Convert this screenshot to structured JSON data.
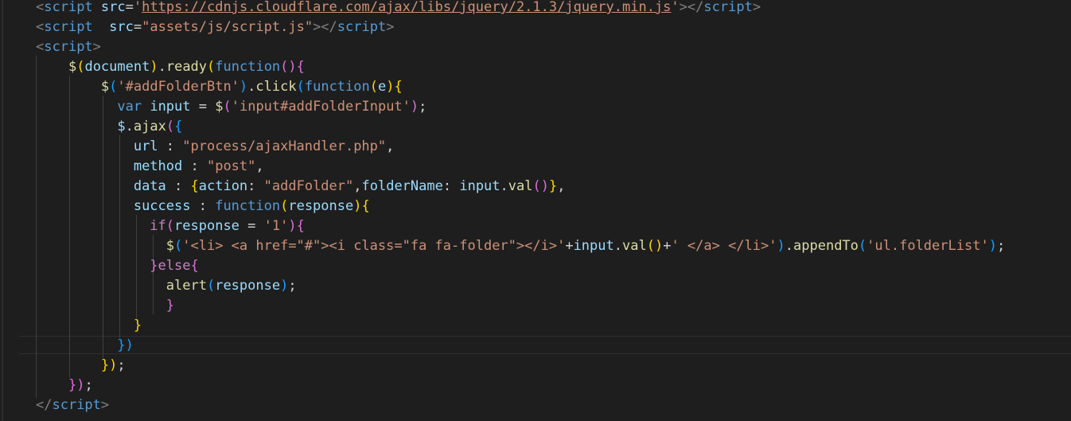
{
  "lines": [
    [
      {
        "t": "<",
        "c": "tok-bracket"
      },
      {
        "t": "script",
        "c": "tok-tag"
      },
      {
        "t": " ",
        "c": "tok-plain"
      },
      {
        "t": "src",
        "c": "tok-attr"
      },
      {
        "t": "=",
        "c": "tok-plain"
      },
      {
        "t": "'",
        "c": "tok-str"
      },
      {
        "t": "https://cdnjs.cloudflare.com/ajax/libs/jquery/2.1.3/jquery.min.js",
        "c": "tok-link"
      },
      {
        "t": "'",
        "c": "tok-str"
      },
      {
        "t": "></",
        "c": "tok-bracket"
      },
      {
        "t": "script",
        "c": "tok-tag"
      },
      {
        "t": ">",
        "c": "tok-bracket"
      }
    ],
    [
      {
        "t": "<",
        "c": "tok-bracket"
      },
      {
        "t": "script",
        "c": "tok-tag"
      },
      {
        "t": "  ",
        "c": "tok-plain"
      },
      {
        "t": "src",
        "c": "tok-attr"
      },
      {
        "t": "=",
        "c": "tok-plain"
      },
      {
        "t": "\"assets/js/script.js\"",
        "c": "tok-str"
      },
      {
        "t": "></",
        "c": "tok-bracket"
      },
      {
        "t": "script",
        "c": "tok-tag"
      },
      {
        "t": ">",
        "c": "tok-bracket"
      }
    ],
    [
      {
        "t": "<",
        "c": "tok-bracket"
      },
      {
        "t": "script",
        "c": "tok-tag"
      },
      {
        "t": ">",
        "c": "tok-bracket"
      }
    ],
    [
      {
        "t": "    ",
        "c": "tok-plain"
      },
      {
        "t": "$",
        "c": "tok-fn"
      },
      {
        "t": "(",
        "c": "b1"
      },
      {
        "t": "document",
        "c": "tok-var"
      },
      {
        "t": ")",
        "c": "b1"
      },
      {
        "t": ".",
        "c": "tok-plain"
      },
      {
        "t": "ready",
        "c": "tok-fn"
      },
      {
        "t": "(",
        "c": "b1"
      },
      {
        "t": "function",
        "c": "tok-kw"
      },
      {
        "t": "()",
        "c": "b2"
      },
      {
        "t": "{",
        "c": "b2"
      }
    ],
    [
      {
        "t": "        ",
        "c": "tok-plain"
      },
      {
        "t": "$",
        "c": "tok-fn"
      },
      {
        "t": "(",
        "c": "b3"
      },
      {
        "t": "'#addFolderBtn'",
        "c": "tok-str"
      },
      {
        "t": ")",
        "c": "b3"
      },
      {
        "t": ".",
        "c": "tok-plain"
      },
      {
        "t": "click",
        "c": "tok-fn"
      },
      {
        "t": "(",
        "c": "b3"
      },
      {
        "t": "function",
        "c": "tok-kw"
      },
      {
        "t": "(",
        "c": "b1"
      },
      {
        "t": "e",
        "c": "tok-var"
      },
      {
        "t": ")",
        "c": "b1"
      },
      {
        "t": "{",
        "c": "b1"
      }
    ],
    [
      {
        "t": "          ",
        "c": "tok-plain"
      },
      {
        "t": "var",
        "c": "tok-kw"
      },
      {
        "t": " ",
        "c": "tok-plain"
      },
      {
        "t": "input",
        "c": "tok-var"
      },
      {
        "t": " = ",
        "c": "tok-plain"
      },
      {
        "t": "$",
        "c": "tok-fn"
      },
      {
        "t": "(",
        "c": "b2"
      },
      {
        "t": "'input#addFolderInput'",
        "c": "tok-str"
      },
      {
        "t": ")",
        "c": "b2"
      },
      {
        "t": ";",
        "c": "tok-plain"
      }
    ],
    [
      {
        "t": "          ",
        "c": "tok-plain"
      },
      {
        "t": "$",
        "c": "tok-var"
      },
      {
        "t": ".",
        "c": "tok-plain"
      },
      {
        "t": "ajax",
        "c": "tok-fn"
      },
      {
        "t": "(",
        "c": "b2"
      },
      {
        "t": "{",
        "c": "b3"
      }
    ],
    [
      {
        "t": "            ",
        "c": "tok-plain"
      },
      {
        "t": "url",
        "c": "tok-var"
      },
      {
        "t": " : ",
        "c": "tok-plain"
      },
      {
        "t": "\"process/ajaxHandler.php\"",
        "c": "tok-str"
      },
      {
        "t": ",",
        "c": "tok-plain"
      }
    ],
    [
      {
        "t": "            ",
        "c": "tok-plain"
      },
      {
        "t": "method",
        "c": "tok-var"
      },
      {
        "t": " : ",
        "c": "tok-plain"
      },
      {
        "t": "\"post\"",
        "c": "tok-str"
      },
      {
        "t": ",",
        "c": "tok-plain"
      }
    ],
    [
      {
        "t": "            ",
        "c": "tok-plain"
      },
      {
        "t": "data",
        "c": "tok-var"
      },
      {
        "t": " : ",
        "c": "tok-plain"
      },
      {
        "t": "{",
        "c": "b1"
      },
      {
        "t": "action",
        "c": "tok-var"
      },
      {
        "t": ": ",
        "c": "tok-plain"
      },
      {
        "t": "\"addFolder\"",
        "c": "tok-str"
      },
      {
        "t": ",",
        "c": "tok-plain"
      },
      {
        "t": "folderName",
        "c": "tok-var"
      },
      {
        "t": ": ",
        "c": "tok-plain"
      },
      {
        "t": "input",
        "c": "tok-var"
      },
      {
        "t": ".",
        "c": "tok-plain"
      },
      {
        "t": "val",
        "c": "tok-fn"
      },
      {
        "t": "()",
        "c": "b2"
      },
      {
        "t": "}",
        "c": "b1"
      },
      {
        "t": ",",
        "c": "tok-plain"
      }
    ],
    [
      {
        "t": "            ",
        "c": "tok-plain"
      },
      {
        "t": "success",
        "c": "tok-var"
      },
      {
        "t": " : ",
        "c": "tok-plain"
      },
      {
        "t": "function",
        "c": "tok-kw"
      },
      {
        "t": "(",
        "c": "b1"
      },
      {
        "t": "response",
        "c": "tok-var"
      },
      {
        "t": ")",
        "c": "b1"
      },
      {
        "t": "{",
        "c": "b1"
      }
    ],
    [
      {
        "t": "              ",
        "c": "tok-plain"
      },
      {
        "t": "if",
        "c": "tok-ctrl"
      },
      {
        "t": "(",
        "c": "b2"
      },
      {
        "t": "response",
        "c": "tok-var"
      },
      {
        "t": " = ",
        "c": "tok-plain"
      },
      {
        "t": "'1'",
        "c": "tok-str"
      },
      {
        "t": ")",
        "c": "b2"
      },
      {
        "t": "{",
        "c": "b2"
      }
    ],
    [
      {
        "t": "                ",
        "c": "tok-plain"
      },
      {
        "t": "$",
        "c": "tok-fn"
      },
      {
        "t": "(",
        "c": "b3"
      },
      {
        "t": "'<li> <a href=\"#\"><i class=\"fa fa-folder\"></i>'",
        "c": "tok-str"
      },
      {
        "t": "+",
        "c": "tok-plain"
      },
      {
        "t": "input",
        "c": "tok-var"
      },
      {
        "t": ".",
        "c": "tok-plain"
      },
      {
        "t": "val",
        "c": "tok-fn"
      },
      {
        "t": "()",
        "c": "b1"
      },
      {
        "t": "+",
        "c": "tok-plain"
      },
      {
        "t": "' </a> </li>'",
        "c": "tok-str"
      },
      {
        "t": ")",
        "c": "b3"
      },
      {
        "t": ".",
        "c": "tok-plain"
      },
      {
        "t": "appendTo",
        "c": "tok-fn"
      },
      {
        "t": "(",
        "c": "b3"
      },
      {
        "t": "'ul.folderList'",
        "c": "tok-str"
      },
      {
        "t": ")",
        "c": "b3"
      },
      {
        "t": ";",
        "c": "tok-plain"
      }
    ],
    [
      {
        "t": "              ",
        "c": "tok-plain"
      },
      {
        "t": "}",
        "c": "b2"
      },
      {
        "t": "else",
        "c": "tok-ctrl"
      },
      {
        "t": "{",
        "c": "b2"
      }
    ],
    [
      {
        "t": "                ",
        "c": "tok-plain"
      },
      {
        "t": "alert",
        "c": "tok-fn"
      },
      {
        "t": "(",
        "c": "b3"
      },
      {
        "t": "response",
        "c": "tok-var"
      },
      {
        "t": ")",
        "c": "b3"
      },
      {
        "t": ";",
        "c": "tok-plain"
      }
    ],
    [
      {
        "t": "                ",
        "c": "tok-plain"
      },
      {
        "t": "}",
        "c": "b2"
      }
    ],
    [
      {
        "t": "            ",
        "c": "tok-plain"
      },
      {
        "t": "}",
        "c": "b1"
      }
    ],
    [
      {
        "t": "          ",
        "c": "tok-plain"
      },
      {
        "t": "})",
        "c": "b3"
      }
    ],
    [
      {
        "t": "        ",
        "c": "tok-plain"
      },
      {
        "t": "})",
        "c": "b1"
      },
      {
        "t": ";",
        "c": "tok-plain"
      }
    ],
    [
      {
        "t": "    ",
        "c": "tok-plain"
      },
      {
        "t": "})",
        "c": "b2"
      },
      {
        "t": ";",
        "c": "tok-plain"
      }
    ],
    [
      {
        "t": "</",
        "c": "tok-bracket"
      },
      {
        "t": "script",
        "c": "tok-tag"
      },
      {
        "t": ">",
        "c": "tok-bracket"
      }
    ]
  ]
}
